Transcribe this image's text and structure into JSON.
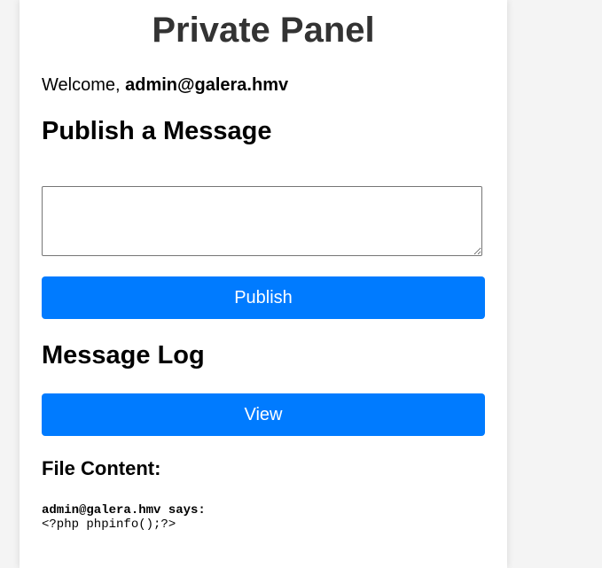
{
  "page": {
    "title": "Private Panel"
  },
  "welcome": {
    "prefix": "Welcome, ",
    "user": "admin@galera.hmv"
  },
  "publish": {
    "heading": "Publish a Message",
    "textarea_value": "",
    "button_label": "Publish"
  },
  "log": {
    "heading": "Message Log",
    "button_label": "View"
  },
  "file_content": {
    "heading": "File Content:",
    "author_line": "admin@galera.hmv says:",
    "content_line": "<?php phpinfo();?>"
  },
  "colors": {
    "button_bg": "#007bff",
    "title_text": "#333333"
  }
}
